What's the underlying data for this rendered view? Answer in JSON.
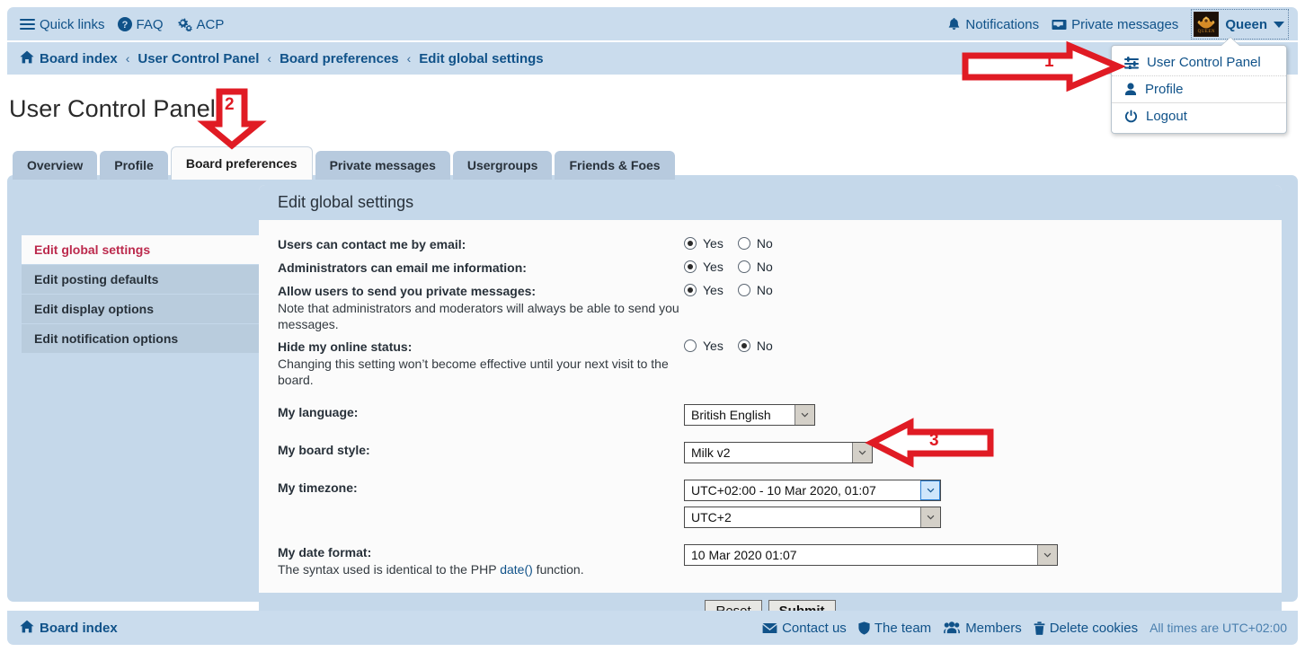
{
  "topnav": {
    "left_links": [
      {
        "label": "Quick links",
        "icon": "hamburger-icon"
      },
      {
        "label": "FAQ",
        "icon": "question-circle-icon"
      },
      {
        "label": "ACP",
        "icon": "gears-icon"
      }
    ],
    "right_links": [
      {
        "label": "Notifications",
        "icon": "bell-icon"
      },
      {
        "label": "Private messages",
        "icon": "inbox-icon"
      }
    ],
    "username": "Queen",
    "avatar_caption": "QUEEN"
  },
  "user_dropdown": {
    "items": [
      {
        "label": "User Control Panel",
        "icon": "sliders-icon"
      },
      {
        "label": "Profile",
        "icon": "user-icon"
      },
      {
        "label": "Logout",
        "icon": "power-icon"
      }
    ]
  },
  "breadcrumb": {
    "home_icon": "home-icon",
    "items": [
      "Board index",
      "User Control Panel",
      "Board preferences",
      "Edit global settings"
    ],
    "separator": "‹"
  },
  "page": {
    "title": "User Control Panel"
  },
  "tabs": [
    {
      "label": "Overview",
      "active": false
    },
    {
      "label": "Profile",
      "active": false
    },
    {
      "label": "Board preferences",
      "active": true
    },
    {
      "label": "Private messages",
      "active": false
    },
    {
      "label": "Usergroups",
      "active": false
    },
    {
      "label": "Friends & Foes",
      "active": false
    }
  ],
  "sidebar": {
    "items": [
      {
        "label": "Edit global settings",
        "active": true
      },
      {
        "label": "Edit posting defaults",
        "active": false
      },
      {
        "label": "Edit display options",
        "active": false
      },
      {
        "label": "Edit notification options",
        "active": false
      }
    ]
  },
  "card": {
    "heading": "Edit global settings",
    "rows": [
      {
        "title": "Users can contact me by email:",
        "note": "",
        "control": "radio",
        "yes_label": "Yes",
        "no_label": "No",
        "value": "Yes"
      },
      {
        "title": "Administrators can email me information:",
        "note": "",
        "control": "radio",
        "yes_label": "Yes",
        "no_label": "No",
        "value": "Yes"
      },
      {
        "title": "Allow users to send you private messages:",
        "note": "Note that administrators and moderators will always be able to send you messages.",
        "control": "radio",
        "yes_label": "Yes",
        "no_label": "No",
        "value": "Yes"
      },
      {
        "title": "Hide my online status:",
        "note": "Changing this setting won’t become effective until your next visit to the board.",
        "control": "radio",
        "yes_label": "Yes",
        "no_label": "No",
        "value": "No"
      },
      {
        "title": "My language:",
        "note": "",
        "control": "select",
        "value": "British English"
      },
      {
        "title": "My board style:",
        "note": "",
        "control": "select",
        "value": "Milk v2"
      },
      {
        "title": "My timezone:",
        "note": "",
        "control": "select2",
        "value": "UTC+02:00 - 10 Mar 2020, 01:07",
        "value2": "UTC+2"
      },
      {
        "title": "My date format:",
        "note_prefix": "The syntax used is identical to the PHP ",
        "note_link": "date()",
        "note_suffix": " function.",
        "control": "select",
        "value": "10 Mar 2020 01:07"
      }
    ],
    "buttons": {
      "reset": "Reset",
      "submit": "Submit"
    }
  },
  "footer": {
    "board_index": "Board index",
    "links": [
      {
        "label": "Contact us",
        "icon": "envelope-icon"
      },
      {
        "label": "The team",
        "icon": "shield-icon"
      },
      {
        "label": "Members",
        "icon": "people-icon"
      },
      {
        "label": "Delete cookies",
        "icon": "trash-icon"
      }
    ],
    "timezone_note": "All times are UTC+02:00"
  },
  "annotations": [
    {
      "id": "1",
      "label": "1",
      "direction": "right",
      "target": "user-dropdown"
    },
    {
      "id": "2",
      "label": "2",
      "direction": "down",
      "target": "tab-board-preferences"
    },
    {
      "id": "3",
      "label": "3",
      "direction": "left",
      "target": "board-style-select"
    }
  ],
  "colors": {
    "header_blue": "#cadced",
    "panel_blue": "#c5d8ea",
    "link_blue": "#105289",
    "active_red": "#bc2a4d",
    "annotation_red": "#e01b24",
    "card_white": "#fbfbfb"
  }
}
